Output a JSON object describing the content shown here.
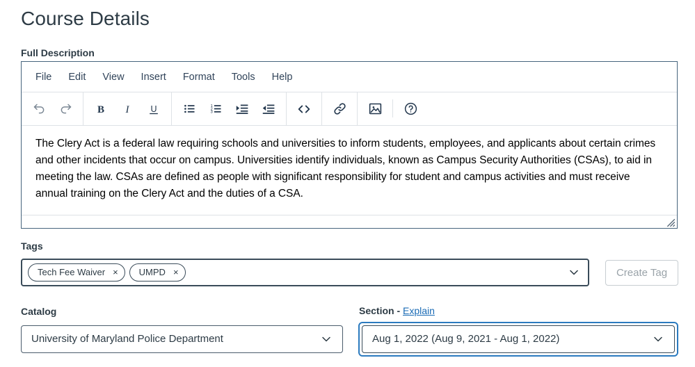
{
  "page": {
    "title": "Course Details"
  },
  "full_description": {
    "label": "Full Description",
    "menubar": [
      {
        "label": "File",
        "name": "menu-file"
      },
      {
        "label": "Edit",
        "name": "menu-edit"
      },
      {
        "label": "View",
        "name": "menu-view"
      },
      {
        "label": "Insert",
        "name": "menu-insert"
      },
      {
        "label": "Format",
        "name": "menu-format"
      },
      {
        "label": "Tools",
        "name": "menu-tools"
      },
      {
        "label": "Help",
        "name": "menu-help"
      }
    ],
    "toolbar": [
      {
        "icon": "undo-icon",
        "title": "Undo"
      },
      {
        "icon": "redo-icon",
        "title": "Redo"
      },
      {
        "icon": "bold-icon",
        "title": "Bold"
      },
      {
        "icon": "italic-icon",
        "title": "Italic"
      },
      {
        "icon": "underline-icon",
        "title": "Underline"
      },
      {
        "icon": "bullet-list-icon",
        "title": "Bullet list"
      },
      {
        "icon": "numbered-list-icon",
        "title": "Numbered list"
      },
      {
        "icon": "increase-indent-icon",
        "title": "Increase indent"
      },
      {
        "icon": "decrease-indent-icon",
        "title": "Decrease indent"
      },
      {
        "icon": "source-code-icon",
        "title": "Source code"
      },
      {
        "icon": "link-icon",
        "title": "Insert link"
      },
      {
        "icon": "image-icon",
        "title": "Insert image"
      },
      {
        "icon": "help-icon",
        "title": "Help"
      }
    ],
    "content": "The Clery Act is a federal law requiring schools and universities to inform students, employees, and applicants about certain crimes and other incidents that occur on campus. Universities identify individuals, known as Campus Security Authorities (CSAs), to aid in meeting the law. CSAs are defined as people with significant responsibility for student and campus activities and must receive annual training on the Clery Act and the duties of a CSA."
  },
  "tags": {
    "label": "Tags",
    "chips": [
      {
        "label": "Tech Fee Waiver",
        "remove": "×"
      },
      {
        "label": "UMPD",
        "remove": "×"
      }
    ],
    "create_button": "Create Tag"
  },
  "catalog": {
    "label": "Catalog",
    "value": "University of Maryland Police Department"
  },
  "section": {
    "label_prefix": "Section - ",
    "label_link": "Explain",
    "value": "Aug 1, 2022 (Aug 9, 2021 - Aug 1, 2022)"
  },
  "colors": {
    "text": "#2d3b45",
    "link": "#1a6bb5",
    "focus_ring": "#2b7abf",
    "border_dark": "#394b59",
    "border_light": "#dee2e6",
    "disabled_text": "#9aa3a9"
  }
}
